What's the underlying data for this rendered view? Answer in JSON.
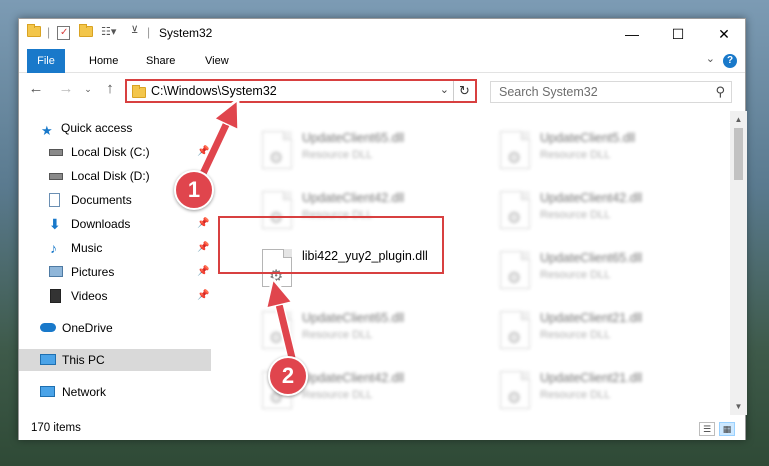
{
  "window": {
    "title": "System32",
    "controls": {
      "minimize": "—",
      "maximize": "☐",
      "close": "✕"
    }
  },
  "ribbon": {
    "tabs": [
      "File",
      "Home",
      "Share",
      "View"
    ],
    "help": "?"
  },
  "address": {
    "path": "C:\\Windows\\System32",
    "search_placeholder": "Search System32"
  },
  "sidebar": {
    "items": [
      {
        "label": "Quick access",
        "icon": "star-icon",
        "pinned": false
      },
      {
        "label": "Local Disk (C:)",
        "icon": "drive-icon",
        "pinned": true
      },
      {
        "label": "Local Disk (D:)",
        "icon": "drive-icon",
        "pinned": true
      },
      {
        "label": "Documents",
        "icon": "documents-icon",
        "pinned": true
      },
      {
        "label": "Downloads",
        "icon": "download-icon",
        "pinned": true
      },
      {
        "label": "Music",
        "icon": "music-icon",
        "pinned": true
      },
      {
        "label": "Pictures",
        "icon": "pictures-icon",
        "pinned": true
      },
      {
        "label": "Videos",
        "icon": "videos-icon",
        "pinned": true
      },
      {
        "label": "OneDrive",
        "icon": "cloud-icon",
        "pinned": false
      },
      {
        "label": "This PC",
        "icon": "computer-icon",
        "pinned": false,
        "selected": true
      },
      {
        "label": "Network",
        "icon": "network-icon",
        "pinned": false
      }
    ]
  },
  "files": {
    "tiles": [
      {
        "name": "UpdateClient65.dll",
        "type": "Resource DLL"
      },
      {
        "name": "UpdateClient5.dll",
        "type": "Resource DLL"
      },
      {
        "name": "UpdateClient42.dll",
        "type": "Resource DLL"
      },
      {
        "name": "UpdateClient42.dll",
        "type": "Resource DLL"
      },
      {
        "name": "libi422_yuy2_plugin.dll",
        "type": ""
      },
      {
        "name": "UpdateClient65.dll",
        "type": "Resource DLL"
      },
      {
        "name": "UpdateClient65.dll",
        "type": "Resource DLL"
      },
      {
        "name": "UpdateClient21.dll",
        "type": "Resource DLL"
      },
      {
        "name": "UpdateClient42.dll",
        "type": "Resource DLL"
      },
      {
        "name": "UpdateClient21.dll",
        "type": "Resource DLL"
      }
    ]
  },
  "status": {
    "count": "170 items"
  },
  "callouts": [
    "1",
    "2"
  ],
  "colors": {
    "accent": "#1979ca",
    "annotation": "#d84040",
    "selected": "#d9d9d9"
  }
}
